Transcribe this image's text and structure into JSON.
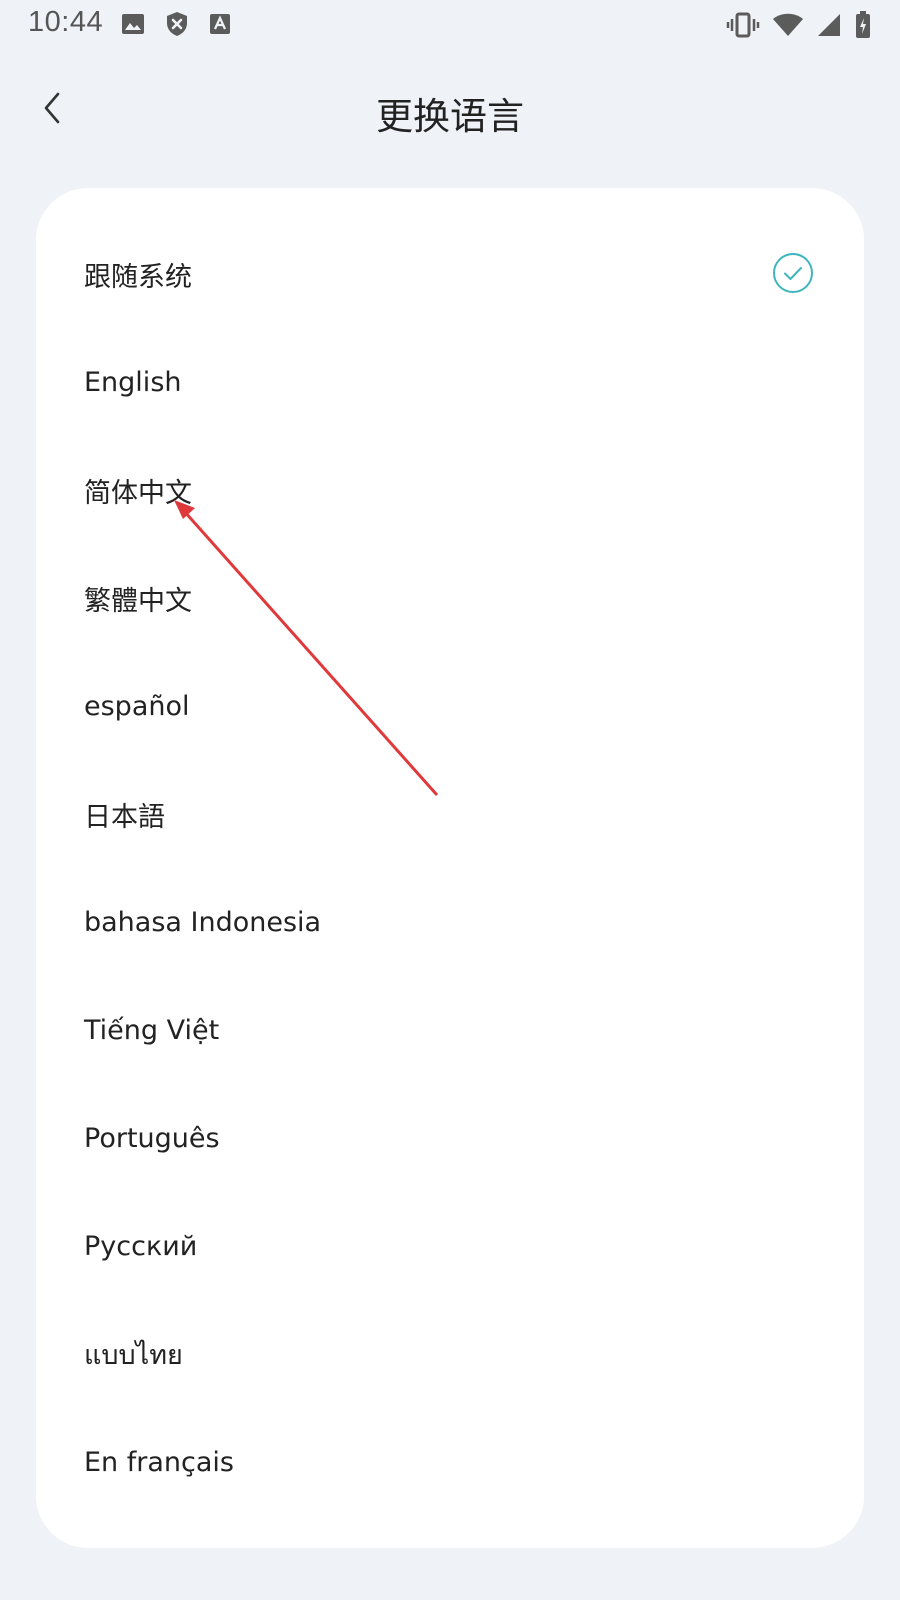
{
  "status_bar": {
    "time": "10:44",
    "left_icons": [
      "image-icon",
      "shield-x-icon",
      "text-a-icon"
    ],
    "right_icons": [
      "vibrate-icon",
      "wifi-icon",
      "signal-icon",
      "battery-charging-icon"
    ]
  },
  "header": {
    "title": "更换语言",
    "back_icon": "chevron-left-icon"
  },
  "languages": [
    {
      "label": "跟随系统",
      "selected": true
    },
    {
      "label": "English",
      "selected": false
    },
    {
      "label": "简体中文",
      "selected": false
    },
    {
      "label": "繁體中文",
      "selected": false
    },
    {
      "label": "español",
      "selected": false
    },
    {
      "label": "日本語",
      "selected": false
    },
    {
      "label": "bahasa Indonesia",
      "selected": false
    },
    {
      "label": "Tiếng Việt",
      "selected": false
    },
    {
      "label": "Português",
      "selected": false
    },
    {
      "label": "Русский",
      "selected": false
    },
    {
      "label": "แบบไทย",
      "selected": false
    },
    {
      "label": "En français",
      "selected": false
    }
  ],
  "colors": {
    "background": "#eff3f7",
    "card": "#ffffff",
    "accent": "#3fb6bd",
    "annotation": "#e0393b"
  }
}
